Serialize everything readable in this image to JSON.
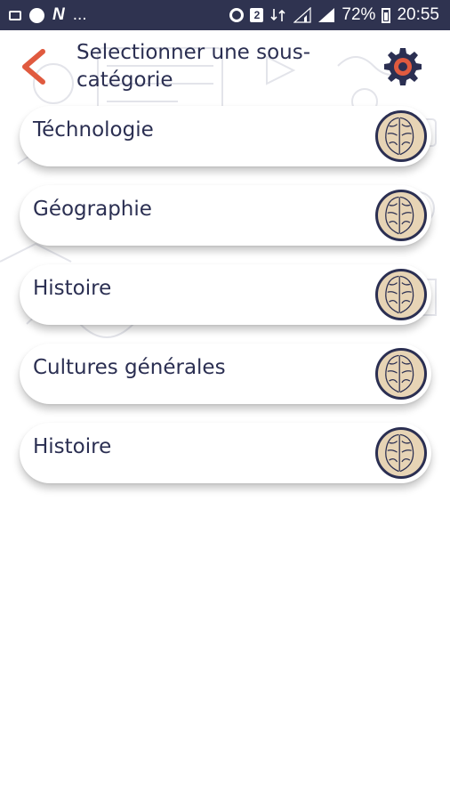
{
  "status_bar": {
    "left_text": "...",
    "badge": "2",
    "battery_percent": "72%",
    "time": "20:55"
  },
  "header": {
    "title": "Selectionner une sous-catégorie",
    "back_icon": "chevron-left-icon",
    "settings_icon": "gear-icon"
  },
  "categories": [
    {
      "label": "Téchnologie",
      "icon": "brain-icon"
    },
    {
      "label": "Géographie",
      "icon": "brain-icon"
    },
    {
      "label": "Histoire",
      "icon": "brain-icon"
    },
    {
      "label": "Cultures générales",
      "icon": "brain-icon"
    },
    {
      "label": "Histoire",
      "icon": "brain-icon"
    }
  ],
  "colors": {
    "status_bar": "#2f3350",
    "text": "#2b2f52",
    "accent": "#e05a3f",
    "icon_fill": "#e7d4b5"
  }
}
